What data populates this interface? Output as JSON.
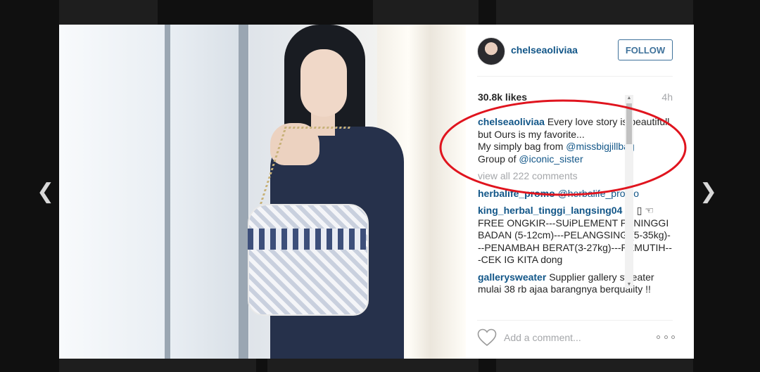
{
  "post": {
    "username": "chelseaoliviaa",
    "follow_label": "FOLLOW",
    "likes": "30.8k likes",
    "time": "4h"
  },
  "caption": {
    "user": "chelseaoliviaa",
    "line1": "Every love story is beautifull,",
    "line2": "but Ours is my favorite...",
    "line3_prefix": "My simply bag from ",
    "line3_mention": "@missbigjillbag",
    "line4_prefix": "Group of ",
    "line4_mention": "@iconic_sister"
  },
  "view_all_comments": "view all 222 comments",
  "comments": [
    {
      "user": "herbalife_promo",
      "text": "@herbalife_promo"
    },
    {
      "user": "king_herbal_tinggi_langsing04",
      "text": "☚ ▯ ☜ FREE ONGKIR---SUiPLEMENT PENINGGI BADAN (5-12cm)---PELANGSING (5-35kg)---PENAMBAH BERAT(3-27kg)---PEMUTIH---CEK IG KITA dong"
    },
    {
      "user": "gallerysweater",
      "text": "Supplier gallery sweater mulai 38 rb ajaa barangnya berquality !!"
    }
  ],
  "add_comment_placeholder": "Add a comment...",
  "icons": {
    "prev": "chevron-left-icon",
    "next": "chevron-right-icon",
    "like": "heart-icon",
    "more": "more-options-icon"
  },
  "colors": {
    "link": "#125688",
    "follow_border": "#3f729b",
    "annotation": "#e0141e"
  }
}
